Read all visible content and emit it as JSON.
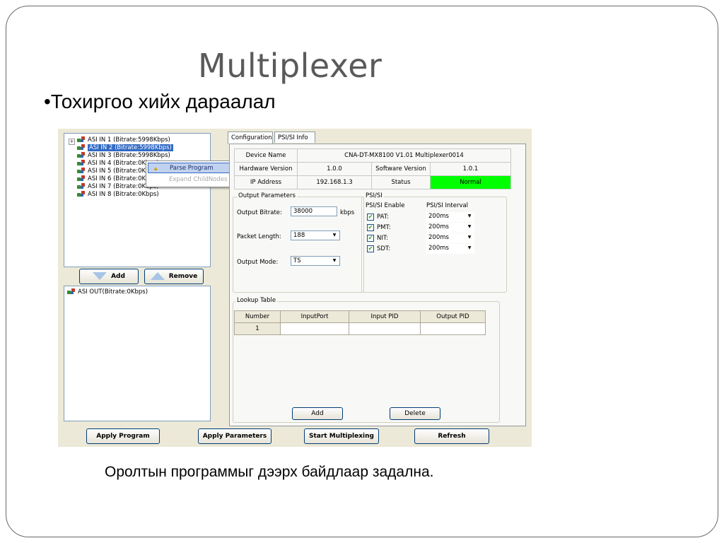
{
  "slide": {
    "title": "Multiplexer",
    "bullet": "•Тохиргоо хийх дараалал",
    "caption": "Оролтын программыг дээрх байдлаар задална."
  },
  "tree": {
    "inputs": [
      {
        "label": "ASI IN 1  (Bitrate:5998Kbps)",
        "selected": false
      },
      {
        "label": "ASI IN 2  (Bitrate:5998Kbps)",
        "selected": true
      },
      {
        "label": "ASI IN 3  (Bitrate:5998Kbps)",
        "selected": false
      },
      {
        "label": "ASI IN 4  (Bitrate:0Kbps)",
        "selected": false
      },
      {
        "label": "ASI IN 5  (Bitrate:0Kbps)",
        "selected": false
      },
      {
        "label": "ASI IN 6  (Bitrate:0Kbps)",
        "selected": false
      },
      {
        "label": "ASI IN 7  (Bitrate:0Kbps)",
        "selected": false
      },
      {
        "label": "ASI IN 8  (Bitrate:0Kbps)",
        "selected": false
      }
    ],
    "context_menu": {
      "parse": "Parse Program",
      "expand": "Expand ChildNodes"
    },
    "add": "Add",
    "remove": "Remove",
    "output": "ASI OUT(Bitrate:0Kbps)"
  },
  "tabs": [
    "Configuration",
    "PSI/SI Info"
  ],
  "device": {
    "device_name_label": "Device Name",
    "device_name": "CNA-DT-MX8100  V1.01  Multiplexer0014",
    "hw_label": "Hardware Version",
    "hw": "1.0.0",
    "sw_label": "Software Version",
    "sw": "1.0.1",
    "ip_label": "IP Address",
    "ip": "192.168.1.3",
    "status_label": "Status",
    "status": "Normal",
    "status_color": "#00ff00"
  },
  "output_params": {
    "title": "Output Parameters",
    "bitrate_label": "Output Bitrate:",
    "bitrate": "38000",
    "bitrate_unit": "kbps",
    "packet_label": "Packet Length:",
    "packet": "188",
    "mode_label": "Output Mode:",
    "mode": "TS"
  },
  "psisi": {
    "title": "PSI/SI",
    "enable_header": "PSI/SI Enable",
    "interval_header": "PSI/SI Interval",
    "rows": [
      {
        "name": "PAT:",
        "checked": true,
        "interval": "200ms"
      },
      {
        "name": "PMT:",
        "checked": true,
        "interval": "200ms"
      },
      {
        "name": "NIT:",
        "checked": true,
        "interval": "200ms"
      },
      {
        "name": "SDT:",
        "checked": true,
        "interval": "200ms"
      }
    ]
  },
  "lookup": {
    "title": "Lookup Table",
    "columns": [
      "Number",
      "InputPort",
      "Input PID",
      "Output PID"
    ],
    "rows": [
      [
        "1",
        "",
        "",
        ""
      ]
    ],
    "add": "Add",
    "delete": "Delete"
  },
  "bottom": {
    "apply_program": "Apply Program",
    "apply_parameters": "Apply Parameters",
    "start": "Start Multiplexing",
    "refresh": "Refresh"
  }
}
